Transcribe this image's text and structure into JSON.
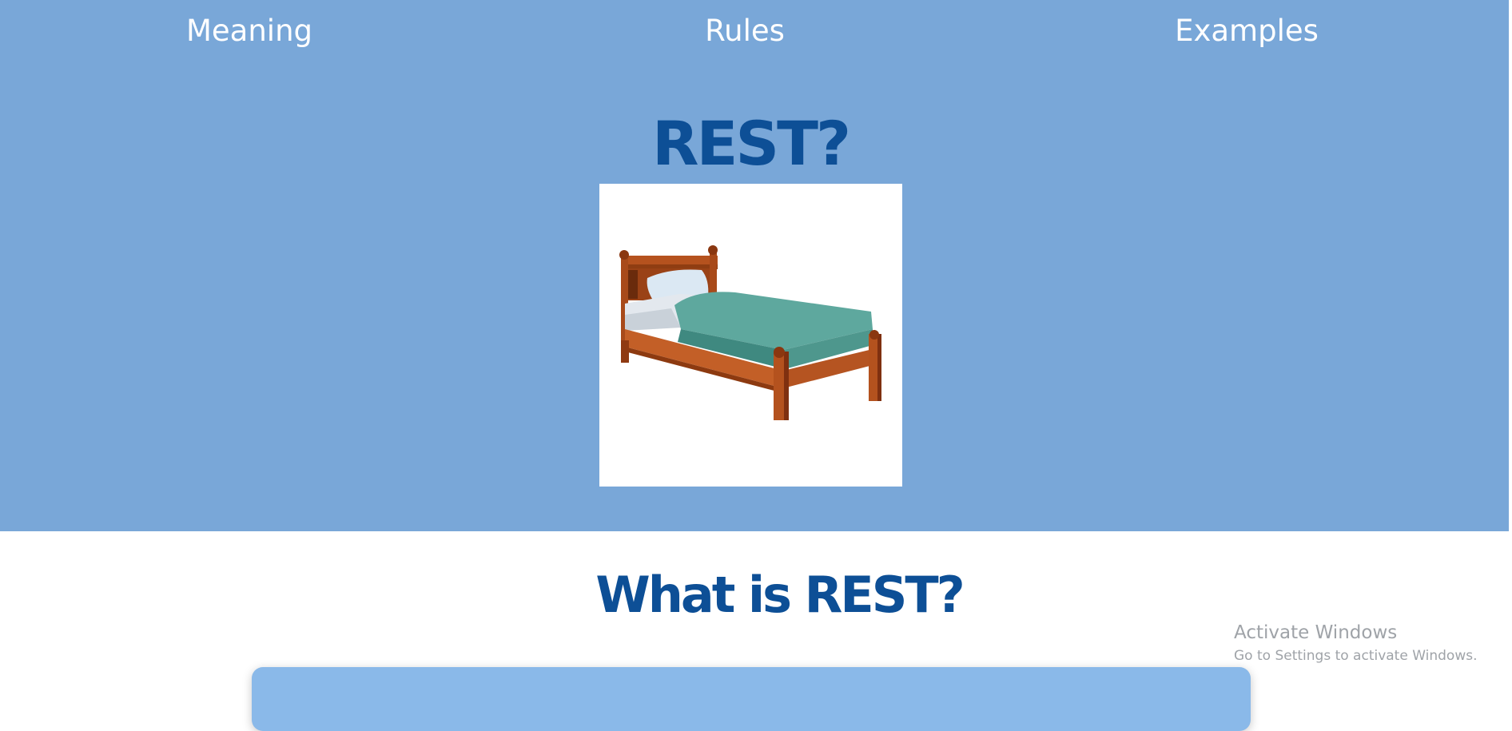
{
  "nav": {
    "items": [
      {
        "label": "Meaning"
      },
      {
        "label": "Rules"
      },
      {
        "label": "Examples"
      }
    ]
  },
  "hero": {
    "title": "REST?",
    "image": {
      "icon": "bed-illustration"
    }
  },
  "section": {
    "title": "What is REST?"
  },
  "watermark": {
    "title": "Activate Windows",
    "subtitle": "Go to Settings to activate Windows."
  },
  "colors": {
    "hero_background": "#79a7d8",
    "heading": "#0d4f96",
    "card_background": "#8ab9e9",
    "watermark_text": "#9fa3a8"
  }
}
